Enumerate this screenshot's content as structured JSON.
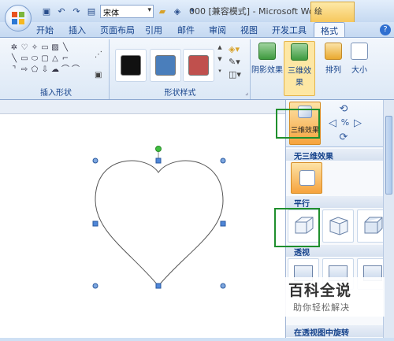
{
  "quick_access": {
    "font_name": "宋体"
  },
  "title": "000 [兼容模式] - Microsoft Wo...",
  "context_tab_group": "绘",
  "tabs": [
    {
      "label": "开始"
    },
    {
      "label": "插入"
    },
    {
      "label": "页面布局"
    },
    {
      "label": "引用"
    },
    {
      "label": "邮件"
    },
    {
      "label": "审阅"
    },
    {
      "label": "视图"
    },
    {
      "label": "开发工具"
    },
    {
      "label": "格式"
    }
  ],
  "ribbon": {
    "insert_shapes_label": "插入形状",
    "shape_styles_label": "形状样式",
    "shadow_effects_label": "阴影效果",
    "effects_3d_label": "三维效果",
    "arrange_label": "排列",
    "size_label": "大小",
    "swatch_colors": [
      "#111111",
      "#4a7ebb",
      "#c0504d"
    ]
  },
  "pane": {
    "effects_3d_button_label": "三维效果",
    "no_3d_header": "无三维效果",
    "parallel_header": "平行",
    "perspective_header": "透视",
    "perspective_rotation_header": "在透视图中旋转"
  },
  "watermark": {
    "title": "百科全说",
    "subtitle": "助你轻松解决"
  },
  "colors": {
    "highlight_green": "#1f8f2d",
    "orange_active": "#f6a33d",
    "ribbon_blue": "#15428b"
  }
}
